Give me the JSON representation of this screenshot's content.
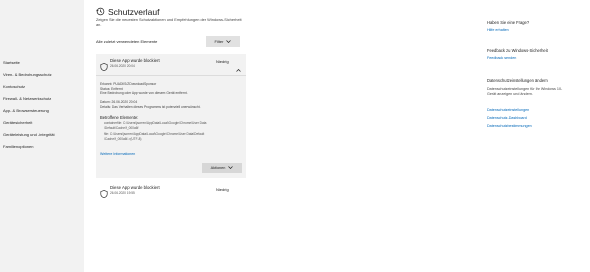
{
  "sidebar": {
    "items": [
      {
        "label": "Startseite"
      },
      {
        "label": "Viren- & Bedrohungsschutz"
      },
      {
        "label": "Kontoschutz"
      },
      {
        "label": "Firewall- & Netzwerkschutz"
      },
      {
        "label": "App- & Browsersteuerung"
      },
      {
        "label": "Gerätesicherheit"
      },
      {
        "label": "Geräteleistung und -integrität"
      },
      {
        "label": "Familienoptionen"
      }
    ]
  },
  "header": {
    "icon": "history-icon",
    "title": "Schutzverlauf",
    "intro": "Zeigen Sie die neuesten Schutzaktionen und Empfehlungen der Windows-Sicherheit an."
  },
  "filter": {
    "label": "Alle zuletzt verwendeten Elemente",
    "button": "Filter"
  },
  "event_expanded": {
    "title": "Diese App wurde blockiert",
    "date": "26.06.2020 20:04",
    "severity": "Niedrig",
    "details": [
      "Erkannt: PUADIIS/ZDownloadSponsor",
      "Status: Entfernt",
      "Eine Bedrohung oder App wurde von diesem Gerät entfernt.",
      "",
      "Datum: 26.06.2020 20:04",
      "Details: Das Verhalten dieses Programms ist potenziell unerwünscht."
    ],
    "affected_title": "Betroffene Elemente:",
    "affected_items": [
      "containerfile: C:\\Users\\jsorren\\AppData\\Local\\Google\\Chrome\\User Data",
      "\\Default\\Cache\\f_000a6f",
      "file: C:\\Users\\jsorren\\AppData\\Local\\Google\\Chrome\\User Data\\Default",
      "\\Cache\\f_000a6f->(UTF-8)"
    ],
    "more_link": "Weitere Informationen",
    "actions_button": "Aktionen"
  },
  "event_collapsed": {
    "title": "Diese App wurde blockiert",
    "date": "26.06.2020 19:55",
    "severity": "Niedrig"
  },
  "right_panel": {
    "question_title": "Haben Sie eine Frage?",
    "help_link": "Hilfe erhalten",
    "feedback_title": "Feedback zu Windows-Sicherheit",
    "feedback_link": "Feedback senden",
    "privacy_title": "Datenschutzeinstellungen ändern",
    "privacy_text": "Datenschutzeinstellungen für Ihr Windows 10-Gerät anzeigen und ändern.",
    "privacy_links": [
      "Datenschutzeinstellungen",
      "Datenschutz-Dashboard",
      "Datenschutzbestimmungen"
    ]
  },
  "colors": {
    "accent": "#0067b8",
    "sidebar_bg": "#f2f2f2",
    "card_bg": "#f2f2f2",
    "button_bg": "#e1e1e1"
  }
}
